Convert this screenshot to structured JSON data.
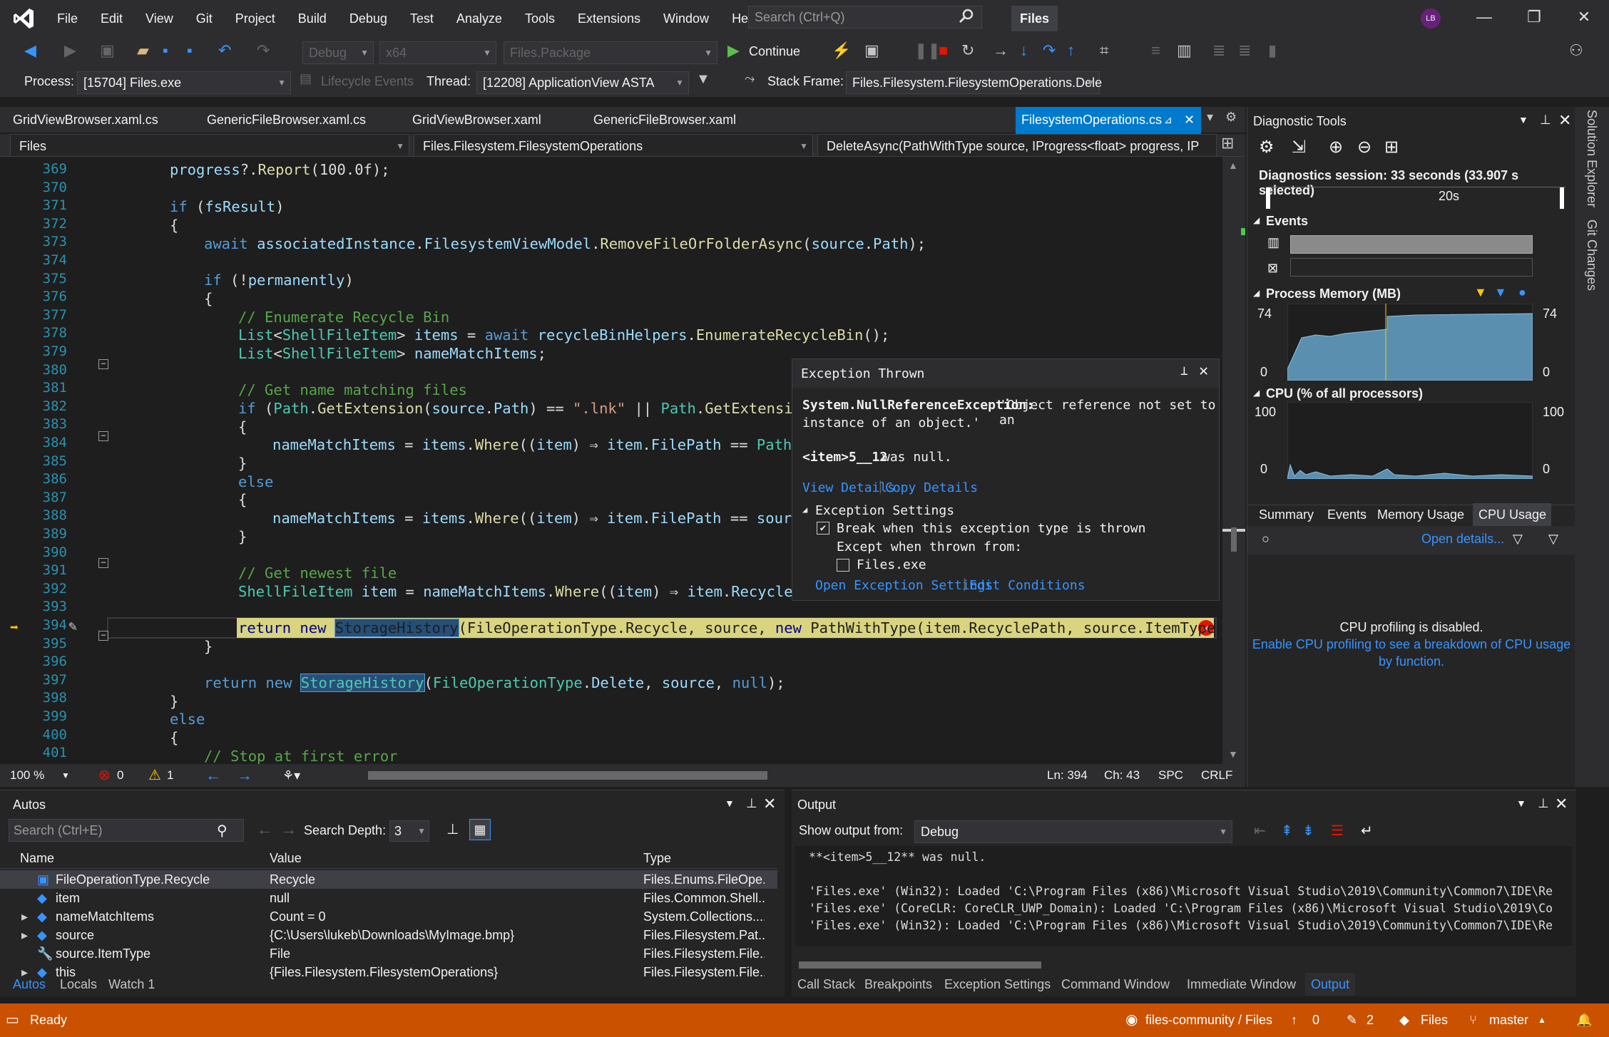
{
  "app": {
    "name": "Files",
    "avatar_initials": "LB",
    "search_placeholder": "Search (Ctrl+Q)"
  },
  "menu": [
    "File",
    "Edit",
    "View",
    "Git",
    "Project",
    "Build",
    "Debug",
    "Test",
    "Analyze",
    "Tools",
    "Extensions",
    "Window",
    "Help"
  ],
  "toolbar": {
    "config": "Debug",
    "platform": "x64",
    "startup": "Files.Package",
    "continue_label": "Continue"
  },
  "debug_location": {
    "process_label": "Process:",
    "process": "[15704] Files.exe",
    "lifecycle": "Lifecycle Events",
    "thread_label": "Thread:",
    "thread": "[12208] ApplicationView ASTA",
    "stack_label": "Stack Frame:",
    "stack": "Files.Filesystem.FilesystemOperations.Dele"
  },
  "doc_tabs": [
    "GridViewBrowser.xaml.cs",
    "GenericFileBrowser.xaml.cs",
    "GridViewBrowser.xaml",
    "GenericFileBrowser.xaml",
    "FilesystemOperations.cs"
  ],
  "nav": {
    "project": "Files",
    "class": "Files.Filesystem.FilesystemOperations",
    "member": "DeleteAsync(PathWithType source, IProgress<float> progress, IP"
  },
  "line_numbers": [
    "369",
    "370",
    "371",
    "372",
    "373",
    "374",
    "375",
    "376",
    "377",
    "378",
    "379",
    "380",
    "381",
    "382",
    "383",
    "384",
    "385",
    "386",
    "387",
    "388",
    "389",
    "390",
    "391",
    "392",
    "393",
    "394",
    "395",
    "396",
    "397",
    "398",
    "399",
    "400",
    "401"
  ],
  "exception": {
    "title": "Exception Thrown",
    "type": "System.NullReferenceException:",
    "message": "'Object reference not set to an",
    "message2": "instance of an object.'",
    "null_var": "<item>5__12",
    "null_suffix": "was null.",
    "view_details": "View Details",
    "copy_details": "Copy Details",
    "settings_header": "Exception Settings",
    "break_label": "Break when this exception type is thrown",
    "except_label": "Except when thrown from:",
    "files_exe": "Files.exe",
    "open_settings": "Open Exception Settings",
    "edit_conditions": "Edit Conditions"
  },
  "editor_status": {
    "zoom": "100 %",
    "errors": "0",
    "warnings": "1",
    "ln": "Ln: 394",
    "ch": "Ch: 43",
    "spc": "SPC",
    "crlf": "CRLF"
  },
  "diag": {
    "title": "Diagnostic Tools",
    "session": "Diagnostics session: 33 seconds (33.907 s selected)",
    "timeline_label": "20s",
    "events": "Events",
    "memory": "Process Memory (MB)",
    "mem_max": "74",
    "mem_min": "0",
    "cpu": "CPU (% of all processors)",
    "cpu_max": "100",
    "cpu_min": "0",
    "tabs": [
      "Summary",
      "Events",
      "Memory Usage",
      "CPU Usage"
    ],
    "open_details": "Open details...",
    "disabled": "CPU profiling is disabled.",
    "enable1": "Enable CPU profiling to see a breakdown of CPU usage",
    "enable2": "by function."
  },
  "side_tabs": [
    "Solution Explorer",
    "Git Changes"
  ],
  "autos": {
    "title": "Autos",
    "search_placeholder": "Search (Ctrl+E)",
    "depth_label": "Search Depth:",
    "depth": "3",
    "columns": [
      "Name",
      "Value",
      "Type"
    ],
    "rows": [
      {
        "name": "FileOperationType.Recycle",
        "value": "Recycle",
        "type": "Files.Enums.FileOpe..."
      },
      {
        "name": "item",
        "value": "null",
        "type": "Files.Common.Shell..."
      },
      {
        "name": "nameMatchItems",
        "value": "Count = 0",
        "type": "System.Collections...."
      },
      {
        "name": "source",
        "value": "{C:\\Users\\lukeb\\Downloads\\MyImage.bmp}",
        "type": "Files.Filesystem.Pat..."
      },
      {
        "name": "source.ItemType",
        "value": "File",
        "type": "Files.Filesystem.File..."
      },
      {
        "name": "this",
        "value": "{Files.Filesystem.FilesystemOperations}",
        "type": "Files.Filesystem.File..."
      }
    ],
    "bottom_tabs": [
      "Autos",
      "Locals",
      "Watch 1"
    ]
  },
  "output": {
    "title": "Output",
    "show_label": "Show output from:",
    "source": "Debug",
    "lines": [
      "**<item>5__12** was null.",
      "",
      "'Files.exe' (Win32): Loaded 'C:\\Program Files (x86)\\Microsoft Visual Studio\\2019\\Community\\Common7\\IDE\\Re",
      "'Files.exe' (CoreCLR: CoreCLR_UWP_Domain): Loaded 'C:\\Program Files (x86)\\Microsoft Visual Studio\\2019\\Co",
      "'Files.exe' (Win32): Loaded 'C:\\Program Files (x86)\\Microsoft Visual Studio\\2019\\Community\\Common7\\IDE\\Re"
    ],
    "bottom_tabs": [
      "Call Stack",
      "Breakpoints",
      "Exception Settings",
      "Command Window",
      "Immediate Window",
      "Output"
    ]
  },
  "statusbar": {
    "ready": "Ready",
    "repo": "files-community / Files",
    "up": "0",
    "pencil": "2",
    "project": "Files",
    "branch": "master"
  }
}
